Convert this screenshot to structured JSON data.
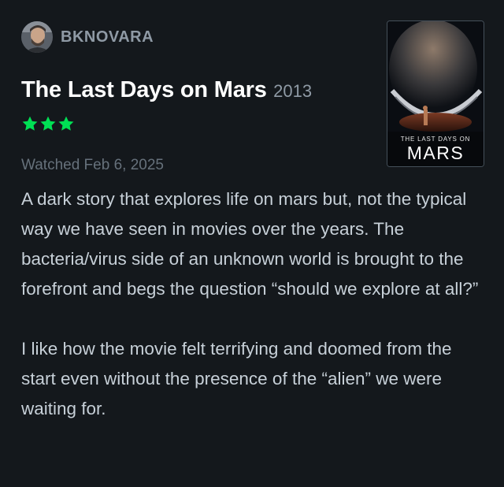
{
  "reviewer": {
    "username": "BKNOVARA",
    "avatar_icon": "person-portrait"
  },
  "film": {
    "title": "The Last Days on Mars",
    "year": "2013",
    "poster": {
      "tagline": "THE LAST DAYS ON",
      "title": "MARS"
    }
  },
  "rating": {
    "stars": 3,
    "star_color": "#00e054"
  },
  "watched_text": "Watched Feb 6, 2025",
  "review": {
    "paragraphs": [
      "A dark story that explores life on mars but, not the typical way we have seen in movies over the years. The bacteria/virus side of an unknown world is brought to the forefront and begs the question “should we explore at all?”",
      "I like how the movie felt terrifying and doomed from the start even without the presence of the “alien” we were waiting for."
    ]
  },
  "colors": {
    "background": "#14181c",
    "title": "#ffffff",
    "body_text": "#c7d0d8",
    "muted_text": "#8f9aa5"
  }
}
